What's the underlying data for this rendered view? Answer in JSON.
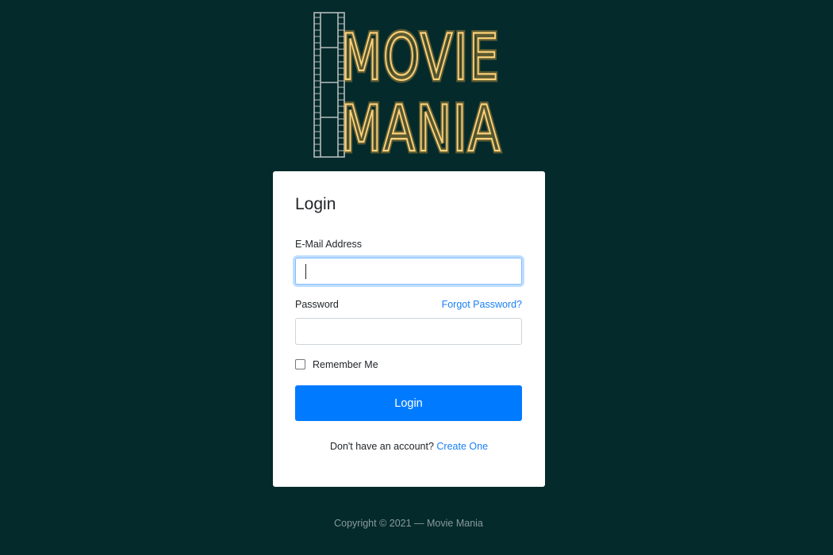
{
  "logo": {
    "line1": "MOVIE",
    "line2": "MANIA"
  },
  "login_card": {
    "title": "Login",
    "email_label": "E-Mail Address",
    "email_value": "",
    "password_label": "Password",
    "password_value": "",
    "forgot_password": "Forgot Password?",
    "remember_me": "Remember Me",
    "remember_me_checked": false,
    "submit": "Login",
    "signup_prompt": "Don't have an account?",
    "signup_link": "Create One"
  },
  "footer": {
    "copyright": "Copyright © 2021 — Movie Mania"
  },
  "colors": {
    "background": "#042a2b",
    "logo_neon": "#ffd27a",
    "primary_button": "#007bff",
    "link": "#1a7ff5"
  }
}
